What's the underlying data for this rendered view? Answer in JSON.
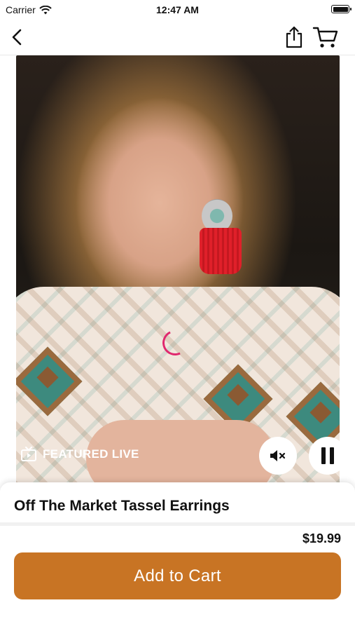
{
  "status_bar": {
    "carrier": "Carrier",
    "time": "12:47 AM",
    "icons": [
      "wifi-icon",
      "battery-icon"
    ]
  },
  "nav": {
    "icons": [
      "back-chevron-icon",
      "share-icon",
      "cart-icon"
    ]
  },
  "video": {
    "badge_label": "FEATURED LIVE",
    "badge_icon": "tv-icon",
    "controls": [
      "mute-icon",
      "pause-icon"
    ],
    "spinner_color": "#e0286e"
  },
  "product": {
    "title": "Off The Market Tassel Earrings",
    "price": "$19.99",
    "add_to_cart_label": "Add to Cart",
    "accent_color": "#c87424"
  }
}
